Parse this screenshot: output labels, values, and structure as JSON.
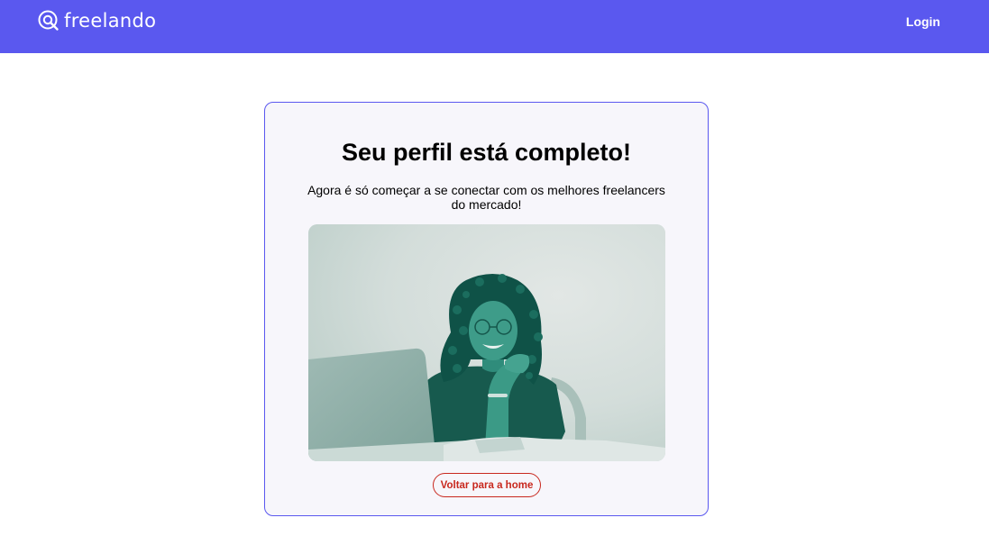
{
  "header": {
    "brand": "freelando",
    "login_label": "Login",
    "logo_icon": "search-magnifier-icon"
  },
  "card": {
    "title": "Seu perfil está completo!",
    "subtitle": "Agora é só começar a se conectar com os melhores freelancers do mercado!",
    "image_alt": "Mulher sorrindo com a mão no queixo em frente a um laptop",
    "button_label": "Voltar para a home"
  },
  "colors": {
    "primary": "#5a58ef",
    "accent": "#c8281e",
    "card_bg": "#f7f6fb",
    "photo_tint": "#1f8a78"
  }
}
